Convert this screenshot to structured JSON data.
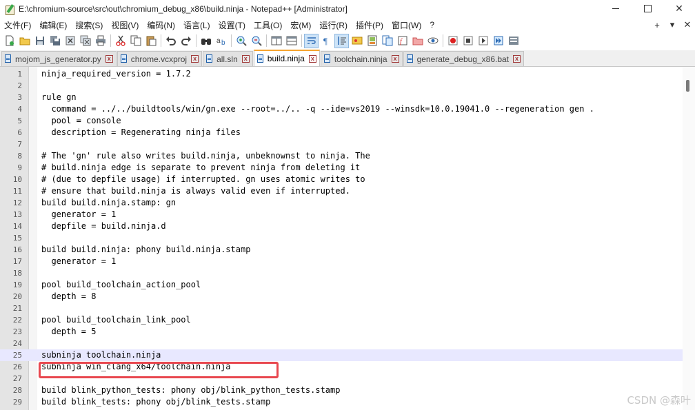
{
  "window": {
    "title": "E:\\chromium-source\\src\\out\\chromium_debug_x86\\build.ninja - Notepad++ [Administrator]",
    "minimize": "—",
    "close": "✕"
  },
  "menu": {
    "items": [
      "文件(F)",
      "编辑(E)",
      "搜索(S)",
      "视图(V)",
      "编码(N)",
      "语言(L)",
      "设置(T)",
      "工具(O)",
      "宏(M)",
      "运行(R)",
      "插件(P)",
      "窗口(W)",
      "?"
    ],
    "right": [
      "+",
      "▾",
      "✕"
    ]
  },
  "tabs": [
    {
      "label": "mojom_js_generator.py",
      "active": false
    },
    {
      "label": "chrome.vcxproj",
      "active": false
    },
    {
      "label": "all.sln",
      "active": false
    },
    {
      "label": "build.ninja",
      "active": true
    },
    {
      "label": "toolchain.ninja",
      "active": false
    },
    {
      "label": "generate_debug_x86.bat",
      "active": false
    }
  ],
  "tab_close_glyph": "x",
  "editor": {
    "current_line": 25,
    "highlighted_line": 26,
    "lines": [
      {
        "n": "1",
        "text": "ninja_required_version = 1.7.2"
      },
      {
        "n": "2",
        "text": ""
      },
      {
        "n": "3",
        "text": "rule gn"
      },
      {
        "n": "4",
        "text": "  command = ../../buildtools/win/gn.exe --root=../.. -q --ide=vs2019 --winsdk=10.0.19041.0 --regeneration gen ."
      },
      {
        "n": "5",
        "text": "  pool = console"
      },
      {
        "n": "6",
        "text": "  description = Regenerating ninja files"
      },
      {
        "n": "7",
        "text": ""
      },
      {
        "n": "8",
        "text": "# The 'gn' rule also writes build.ninja, unbeknownst to ninja. The"
      },
      {
        "n": "9",
        "text": "# build.ninja edge is separate to prevent ninja from deleting it"
      },
      {
        "n": "10",
        "text": "# (due to depfile usage) if interrupted. gn uses atomic writes to"
      },
      {
        "n": "11",
        "text": "# ensure that build.ninja is always valid even if interrupted."
      },
      {
        "n": "12",
        "text": "build build.ninja.stamp: gn"
      },
      {
        "n": "13",
        "text": "  generator = 1"
      },
      {
        "n": "14",
        "text": "  depfile = build.ninja.d"
      },
      {
        "n": "15",
        "text": ""
      },
      {
        "n": "16",
        "text": "build build.ninja: phony build.ninja.stamp"
      },
      {
        "n": "17",
        "text": "  generator = 1"
      },
      {
        "n": "18",
        "text": ""
      },
      {
        "n": "19",
        "text": "pool build_toolchain_action_pool"
      },
      {
        "n": "20",
        "text": "  depth = 8"
      },
      {
        "n": "21",
        "text": ""
      },
      {
        "n": "22",
        "text": "pool build_toolchain_link_pool"
      },
      {
        "n": "23",
        "text": "  depth = 5"
      },
      {
        "n": "24",
        "text": ""
      },
      {
        "n": "25",
        "text": "subninja toolchain.ninja"
      },
      {
        "n": "26",
        "text": "subninja win_clang_x64/toolchain.ninja"
      },
      {
        "n": "27",
        "text": ""
      },
      {
        "n": "28",
        "text": "build blink_python_tests: phony obj/blink_python_tests.stamp"
      },
      {
        "n": "29",
        "text": "build blink_tests: phony obj/blink_tests.stamp"
      }
    ]
  },
  "watermark": "CSDN @森叶",
  "colors": {
    "active_tab_accent": "#f7a52f",
    "current_line_bg": "#e8e8ff",
    "highlight_box": "#e8474f",
    "gutter_bg": "#e4e4e4"
  },
  "toolbar_icons": [
    "new-file-icon",
    "open-file-icon",
    "save-icon",
    "save-all-icon",
    "close-icon",
    "close-all-icon",
    "print-icon",
    "cut-icon",
    "copy-icon",
    "paste-icon",
    "undo-icon",
    "redo-icon",
    "find-icon",
    "replace-icon",
    "zoom-in-icon",
    "zoom-out-icon",
    "sync-vertical-icon",
    "sync-horizontal-icon",
    "word-wrap-icon",
    "show-all-chars-icon",
    "indent-guide-icon",
    "doc-map-icon",
    "function-list-icon",
    "folder-workspace-icon",
    "monitor-icon",
    "document-list-icon",
    "browser-icon",
    "view-icon",
    "record-macro-icon",
    "stop-macro-icon",
    "play-macro-icon",
    "run-macro-multiple-icon",
    "save-macro-icon"
  ]
}
